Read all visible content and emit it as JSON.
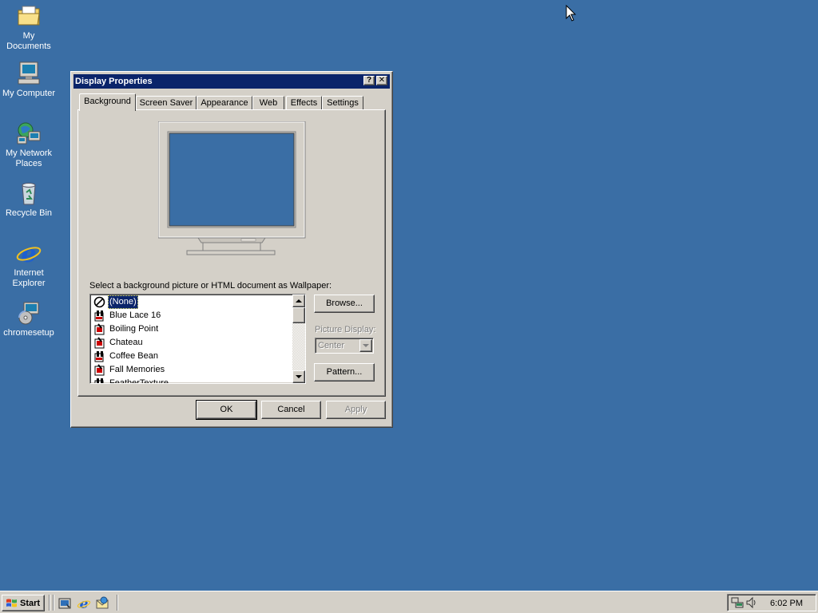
{
  "desktop": {
    "icons": [
      {
        "label": "My Documents",
        "icon": "my-documents-icon"
      },
      {
        "label": "My Computer",
        "icon": "my-computer-icon"
      },
      {
        "label": "My Network Places",
        "icon": "network-places-icon"
      },
      {
        "label": "Recycle Bin",
        "icon": "recycle-bin-icon"
      },
      {
        "label": "Internet Explorer",
        "icon": "internet-explorer-icon"
      },
      {
        "label": "chromesetup",
        "icon": "chromesetup-icon"
      }
    ],
    "background_color": "#3A6EA5"
  },
  "window": {
    "title": "Display Properties",
    "help_label": "?",
    "close_label": "✕",
    "tabs": [
      "Background",
      "Screen Saver",
      "Appearance",
      "Web",
      "Effects",
      "Settings"
    ],
    "active_tab": "Background",
    "wallpaper_label": "Select a background picture or HTML document as Wallpaper:",
    "wallpapers": [
      {
        "label": "(None)",
        "selected": true
      },
      {
        "label": "Blue Lace 16"
      },
      {
        "label": "Boiling Point"
      },
      {
        "label": "Chateau"
      },
      {
        "label": "Coffee Bean"
      },
      {
        "label": "Fall Memories"
      },
      {
        "label": "FeatherTexture"
      }
    ],
    "browse_label": "Browse...",
    "picture_display_label": "Picture Display:",
    "picture_display_value": "Center",
    "pattern_label": "Pattern...",
    "ok_label": "OK",
    "cancel_label": "Cancel",
    "apply_label": "Apply",
    "title_color": "#0A246A"
  },
  "taskbar": {
    "start_label": "Start",
    "clock": "6:02 PM"
  }
}
